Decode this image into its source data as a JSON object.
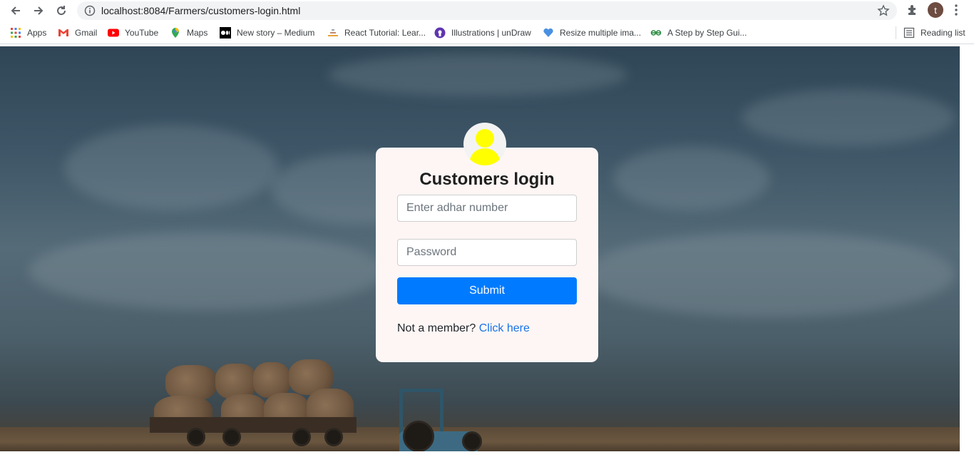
{
  "browser": {
    "url": "localhost:8084/Farmers/customers-login.html",
    "avatar_letter": "t",
    "bookmarks": [
      {
        "label": "Apps",
        "icon": "apps-grid-icon"
      },
      {
        "label": "Gmail",
        "icon": "gmail-icon"
      },
      {
        "label": "YouTube",
        "icon": "youtube-icon"
      },
      {
        "label": "Maps",
        "icon": "maps-pin-icon"
      },
      {
        "label": "New story – Medium",
        "icon": "medium-icon"
      },
      {
        "label": "React Tutorial: Lear...",
        "icon": "react-tutorial-icon"
      },
      {
        "label": "Illustrations | unDraw",
        "icon": "undraw-icon"
      },
      {
        "label": "Resize multiple ima...",
        "icon": "resize-heart-icon"
      },
      {
        "label": "A Step by Step Gui...",
        "icon": "geeks-icon"
      }
    ],
    "reading_list": "Reading list"
  },
  "login": {
    "title": "Customers login",
    "adhar_placeholder": "Enter adhar number",
    "password_placeholder": "Password",
    "submit_label": "Submit",
    "member_text": "Not a member?",
    "member_link": "Click here"
  },
  "colors": {
    "accent": "#007bff",
    "link": "#1a73e8",
    "avatar_user": "#ffff00",
    "card_bg": "#fdf6f5"
  }
}
